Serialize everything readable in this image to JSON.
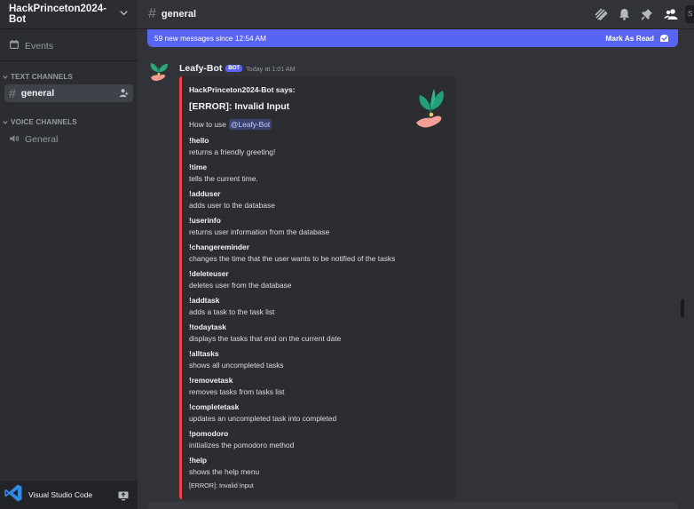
{
  "server": {
    "name": "HackPrinceton2024-Bot"
  },
  "sidebar": {
    "events_label": "Events",
    "text_category": "TEXT CHANNELS",
    "text_channels": [
      {
        "label": "general",
        "active": true
      }
    ],
    "voice_category": "VOICE CHANNELS",
    "voice_channels": [
      {
        "label": "General"
      }
    ]
  },
  "userbar": {
    "label": "Visual Studio Code"
  },
  "header": {
    "channel": "general",
    "search_stub": "S"
  },
  "new_messages": {
    "text": "59 new messages since 12:54 AM",
    "action": "Mark As Read"
  },
  "message": {
    "author": "Leafy-Bot",
    "badge": "BOT",
    "timestamp": "Today at 1:01 AM",
    "embed": {
      "author": "HackPrinceton2024-Bot says:",
      "title": "[ERROR]: Invalid Input",
      "desc_prefix": "How to use",
      "mention": "@Leafy-Bot",
      "fields": [
        {
          "name": "!hello",
          "value": "returns a friendly greeting!"
        },
        {
          "name": "!time",
          "value": "tells the current time."
        },
        {
          "name": "!adduser",
          "value": "adds user to the database"
        },
        {
          "name": "!userinfo",
          "value": "returns user information from the database"
        },
        {
          "name": "!changereminder",
          "value": "changes the time that the user wants to be notified of the tasks"
        },
        {
          "name": "!deleteuser",
          "value": "deletes user from the database"
        },
        {
          "name": "!addtask",
          "value": "adds a task to the task list"
        },
        {
          "name": "!todaytask",
          "value": "displays the tasks that end on the current date"
        },
        {
          "name": "!alltasks",
          "value": "shows all uncompleted tasks"
        },
        {
          "name": "!removetask",
          "value": "removes tasks from tasks list"
        },
        {
          "name": "!completetask",
          "value": "updates an uncompleted task into completed"
        },
        {
          "name": "!pomodoro",
          "value": "initializes the pomodoro method"
        },
        {
          "name": "!help",
          "value": "shows the help menu"
        }
      ],
      "footer": "[ERROR]: Invalid Input",
      "color": "#ed4245"
    }
  },
  "colors": {
    "accent": "#5865f2",
    "background": "#313338",
    "sidebar": "#2b2d31",
    "error": "#ed4245"
  }
}
